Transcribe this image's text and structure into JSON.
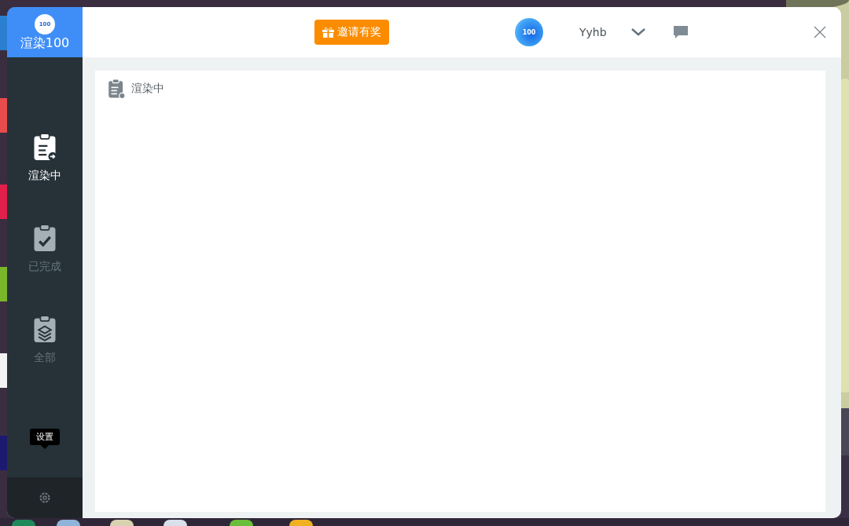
{
  "app": {
    "logo_badge": "100",
    "logo_text": "渲染100"
  },
  "nav": [
    {
      "label": "渲染中",
      "selected": true,
      "kind": "rendering"
    },
    {
      "label": "已完成",
      "selected": false,
      "kind": "done"
    },
    {
      "label": "全部",
      "selected": false,
      "kind": "all"
    }
  ],
  "settings": {
    "tooltip": "设置"
  },
  "topbar": {
    "invite_button": "邀请有奖",
    "avatar_badge": "100",
    "username": "Yyhb"
  },
  "panel": {
    "title": "渲染中"
  }
}
